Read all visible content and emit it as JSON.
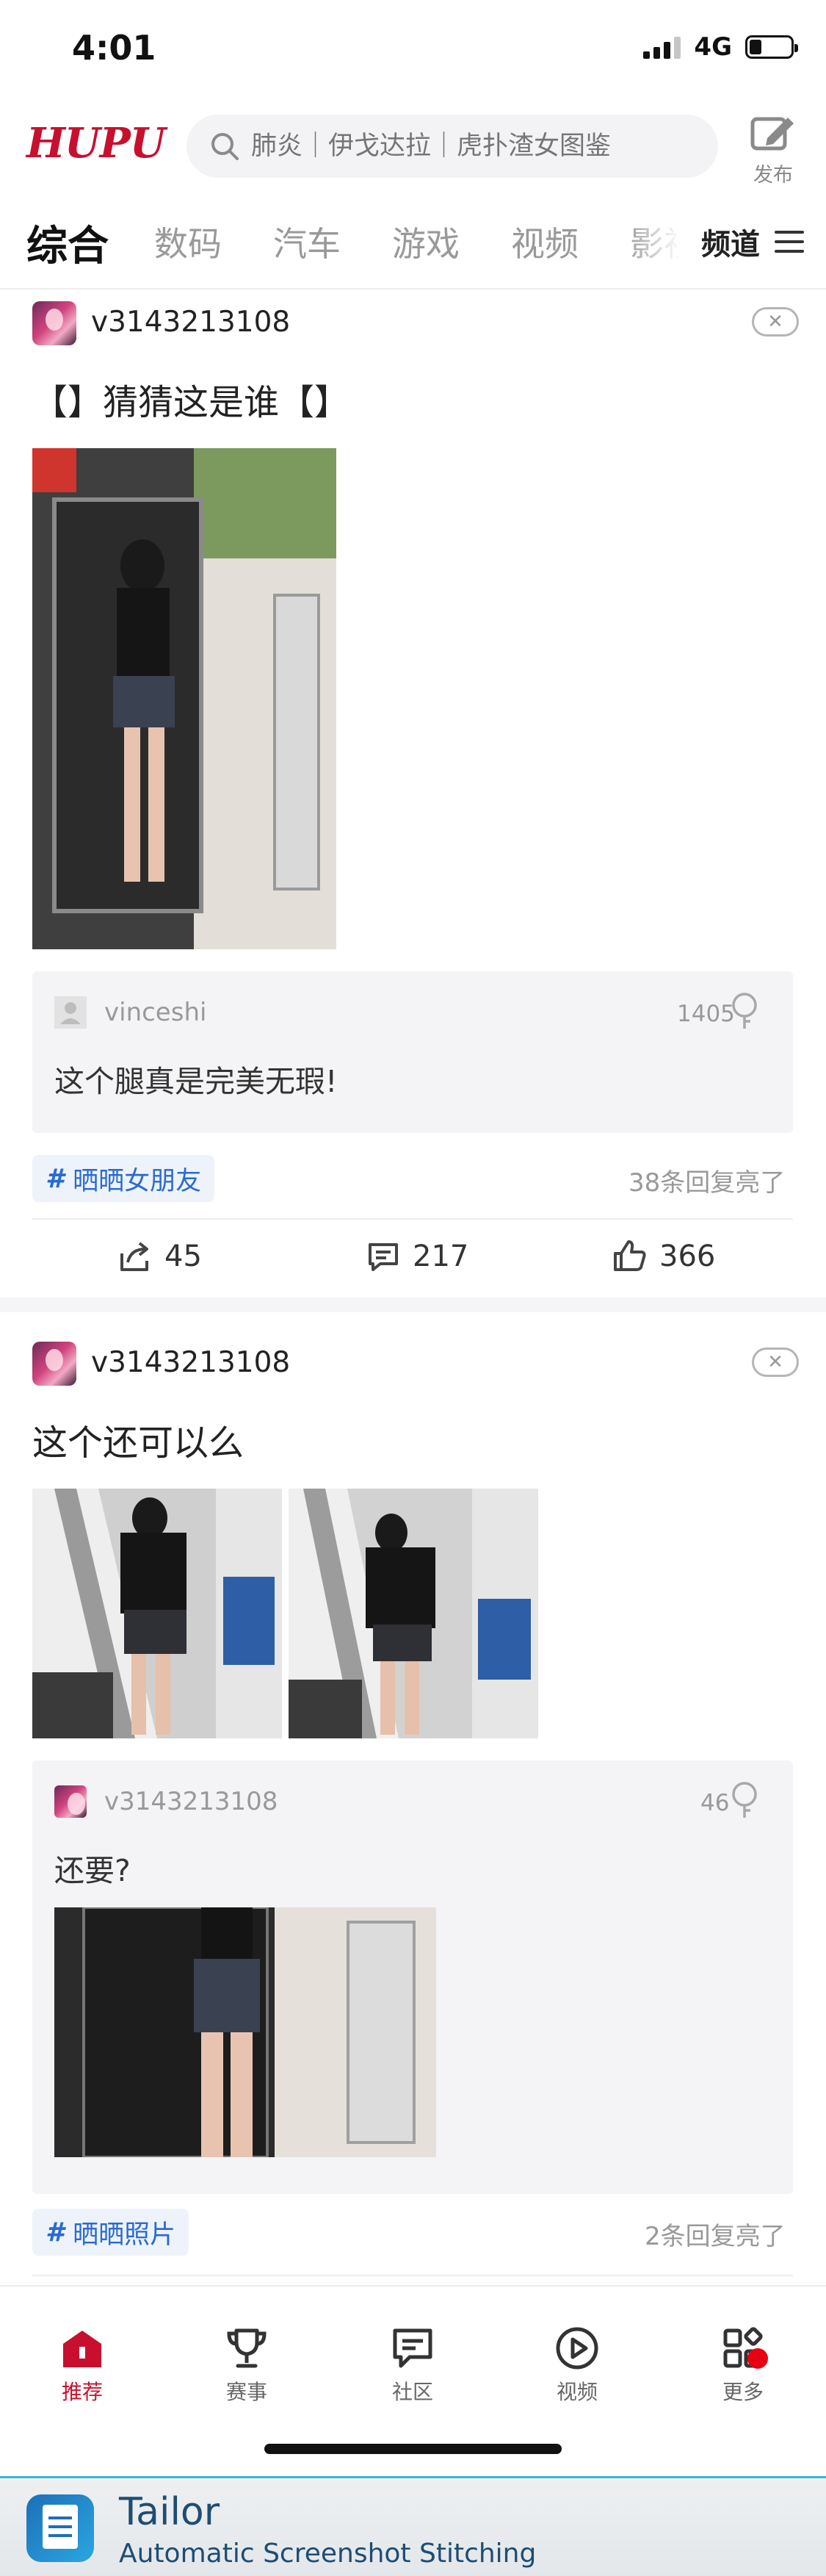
{
  "status_bar": {
    "time": "4:01",
    "network": "4G"
  },
  "header": {
    "logo": "HUPU",
    "search_placeholder": "肺炎｜伊戈达拉｜虎扑渣女图鉴",
    "publish_label": "发布"
  },
  "tabs": {
    "items": [
      "综合",
      "数码",
      "汽车",
      "游戏",
      "视频",
      "影视"
    ],
    "active": "综合",
    "channel_label": "频道"
  },
  "posts": [
    {
      "username": "v3143213108",
      "title": "【】猜猜这是谁【】",
      "hot_comment": {
        "user": "vinceshi",
        "text": "这个腿真是完美无瑕!",
        "light_count": "1405"
      },
      "tag": "晒晒女朋友",
      "light_summary": "38条回复亮了",
      "actions": {
        "share": "45",
        "comments": "217",
        "likes": "366"
      }
    },
    {
      "username": "v3143213108",
      "title": "这个还可以么",
      "hot_comment": {
        "user": "v3143213108",
        "text": "还要?",
        "light_count": "46"
      },
      "tag": "晒晒照片",
      "light_summary": "2条回复亮了"
    }
  ],
  "bottom_nav": [
    {
      "label": "推荐",
      "icon": "home-icon",
      "active": true
    },
    {
      "label": "赛事",
      "icon": "trophy-icon",
      "active": false
    },
    {
      "label": "社区",
      "icon": "chat-icon",
      "active": false
    },
    {
      "label": "视频",
      "icon": "play-icon",
      "active": false
    },
    {
      "label": "更多",
      "icon": "grid-icon",
      "active": false
    }
  ],
  "tailor": {
    "name": "Tailor",
    "subtitle": "Automatic Screenshot Stitching"
  },
  "colors": {
    "brand_red": "#c8102e",
    "tag_blue": "#2a6ad1",
    "accent_cyan": "#39b7d8"
  }
}
